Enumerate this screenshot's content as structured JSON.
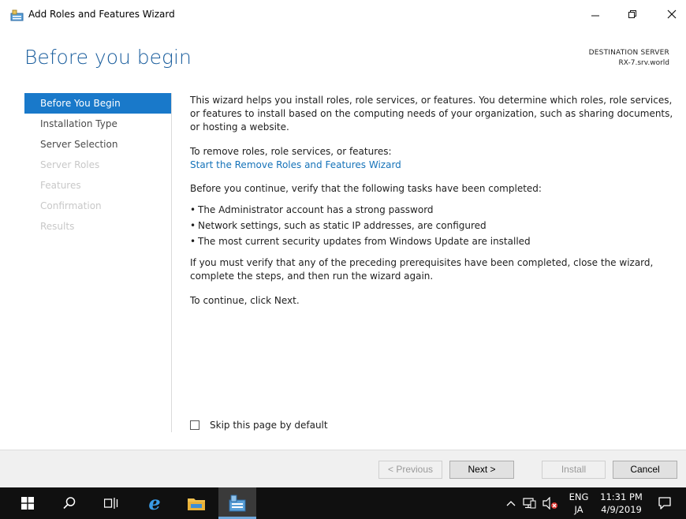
{
  "window": {
    "title": "Add Roles and Features Wizard",
    "controls": {
      "minimize": "—",
      "maximize": "❐",
      "close": "✕"
    }
  },
  "header": {
    "page_title": "Before you begin",
    "destination_label": "DESTINATION SERVER",
    "destination_server": "RX-7.srv.world"
  },
  "nav": {
    "items": [
      {
        "label": "Before You Begin",
        "state": "active"
      },
      {
        "label": "Installation Type",
        "state": "enabled"
      },
      {
        "label": "Server Selection",
        "state": "enabled"
      },
      {
        "label": "Server Roles",
        "state": "disabled"
      },
      {
        "label": "Features",
        "state": "disabled"
      },
      {
        "label": "Confirmation",
        "state": "disabled"
      },
      {
        "label": "Results",
        "state": "disabled"
      }
    ]
  },
  "content": {
    "intro": "This wizard helps you install roles, role services, or features. You determine which roles, role services, or features to install based on the computing needs of your organization, such as sharing documents, or hosting a website.",
    "remove_label": "To remove roles, role services, or features:",
    "remove_link": "Start the Remove Roles and Features Wizard",
    "verify_intro": "Before you continue, verify that the following tasks have been completed:",
    "tasks": [
      "The Administrator account has a strong password",
      "Network settings, such as static IP addresses, are configured",
      "The most current security updates from Windows Update are installed"
    ],
    "prereq_note": "If you must verify that any of the preceding prerequisites have been completed, close the wizard, complete the steps, and then run the wizard again.",
    "continue_note": "To continue, click Next."
  },
  "skip": {
    "label": "Skip this page by default",
    "checked": false
  },
  "footer": {
    "previous": "< Previous",
    "next": "Next >",
    "install": "Install",
    "cancel": "Cancel"
  },
  "taskbar": {
    "icons": [
      "start-icon",
      "search-icon",
      "task-view-icon",
      "edge-icon",
      "file-explorer-icon",
      "server-manager-icon"
    ],
    "tray": {
      "chevron": "^",
      "lang_top": "ENG",
      "lang_bottom": "JA",
      "time": "11:31 PM",
      "date": "4/9/2019"
    }
  },
  "colors": {
    "title_blue": "#1c5f9e",
    "nav_active": "#1979ca",
    "link": "#1673b9",
    "taskbar": "#101010"
  }
}
